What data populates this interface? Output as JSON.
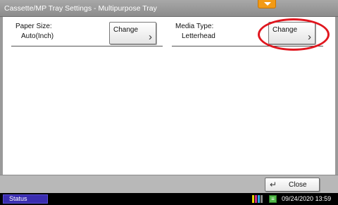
{
  "window": {
    "title": "Cassette/MP Tray Settings - Multipurpose Tray",
    "collapse_icon": "chevron-down-icon",
    "accent_color": "#f29a16"
  },
  "settings": [
    {
      "label": "Paper Size:",
      "value": "Auto(Inch)",
      "button_label": "Change",
      "button_icon": "chevron-right-icon"
    },
    {
      "label": "Media Type:",
      "value": "Letterhead",
      "button_label": "Change",
      "button_icon": "chevron-right-icon"
    }
  ],
  "annotation": {
    "color": "#e0171f"
  },
  "footer": {
    "close_label": "Close",
    "close_icon": "return-arrow-icon"
  },
  "statusbar": {
    "status_label": "Status",
    "date": "09/24/2020",
    "time": "13:59",
    "toner_colors": [
      "#e8d400",
      "#d02a8c",
      "#2aa7e0",
      "#222222"
    ]
  }
}
